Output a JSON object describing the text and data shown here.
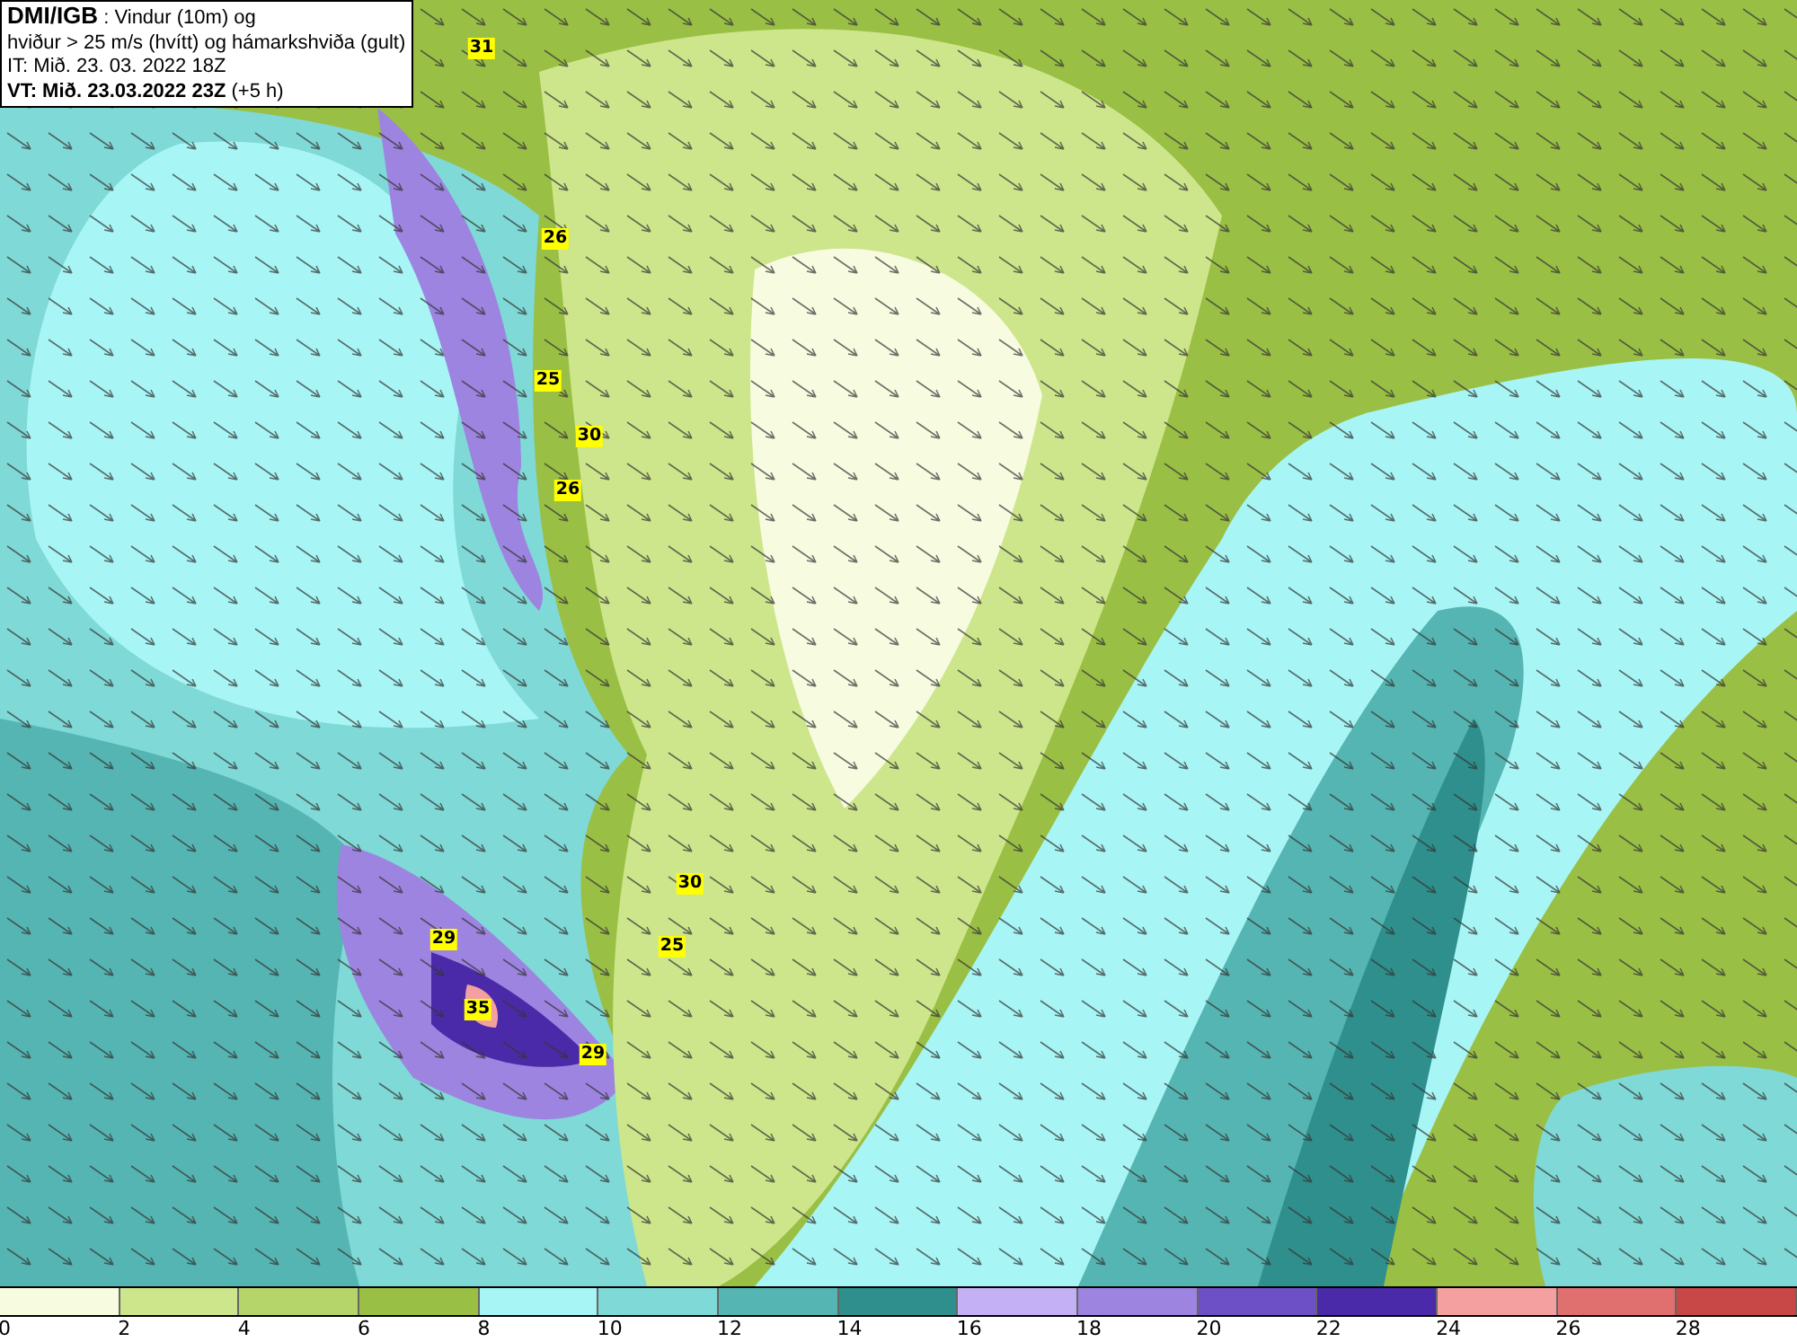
{
  "title_box": {
    "lines": [
      "**DMI/IGB** : Vindur (10m) og",
      "hviður > 25 m/s (hvítt) og hámarkshviða (gult)",
      "IT: Mið. 23. 03. 2022 18Z",
      "**VT: Mið. 23.03.2022 23Z** (+5 h)"
    ]
  },
  "gust_markers": [
    "31",
    "26",
    "25",
    "30",
    "26",
    "30",
    "25",
    "29",
    "35",
    "29"
  ],
  "legend": [
    {
      "label": "0",
      "color": "#f7fbe0"
    },
    {
      "label": "2",
      "color": "#cde68b"
    },
    {
      "label": "4",
      "color": "#b5d56a"
    },
    {
      "label": "6",
      "color": "#9abf45"
    },
    {
      "label": "8",
      "color": "#a8f5f5"
    },
    {
      "label": "10",
      "color": "#7fd9d6"
    },
    {
      "label": "12",
      "color": "#55b5b2"
    },
    {
      "label": "14",
      "color": "#2e8f8c"
    },
    {
      "label": "16",
      "color": "#c4b0f5"
    },
    {
      "label": "18",
      "color": "#9d84e0"
    },
    {
      "label": "20",
      "color": "#6e50c6"
    },
    {
      "label": "22",
      "color": "#4a2aa8"
    },
    {
      "label": "24",
      "color": "#f4a0a0"
    },
    {
      "label": "26",
      "color": "#e07070"
    },
    {
      "label": "28",
      "color": "#c84848"
    }
  ]
}
